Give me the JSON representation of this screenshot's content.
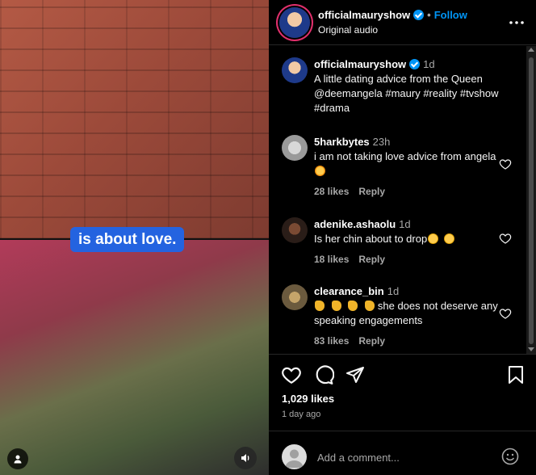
{
  "media": {
    "caption": "is about love."
  },
  "header": {
    "username": "officialmauryshow",
    "separator": "•",
    "follow_label": "Follow",
    "audio_label": "Original audio"
  },
  "post": {
    "username": "officialmauryshow",
    "time": "1d",
    "caption": "A little dating advice from the Queen @deemangela #maury #reality #tvshow #drama"
  },
  "comments": [
    {
      "username": "5harkbytes",
      "time": "23h",
      "text": "i am not taking love advice from angela",
      "likes": "28 likes",
      "reply_label": "Reply"
    },
    {
      "username": "adenike.ashaolu",
      "time": "1d",
      "text": "Is her chin about to drop",
      "likes": "18 likes",
      "reply_label": "Reply"
    },
    {
      "username": "clearance_bin",
      "time": "1d",
      "text": "she does not deserve any speaking engagements",
      "likes": "83 likes",
      "reply_label": "Reply"
    }
  ],
  "footer": {
    "likes": "1,029 likes",
    "time_ago": "1 day ago",
    "comment_placeholder": "Add a comment..."
  },
  "icons": {
    "heart": "heart-icon",
    "comment": "comment-icon",
    "share": "share-icon",
    "save": "bookmark-icon",
    "more": "more-icon",
    "emoji": "emoji-icon",
    "user_tag": "user-icon",
    "audio": "speaker-icon"
  },
  "colors": {
    "accent": "#0095f6",
    "caption_pill": "#2463e0",
    "background": "#000000",
    "muted_text": "#a8a8a8"
  }
}
